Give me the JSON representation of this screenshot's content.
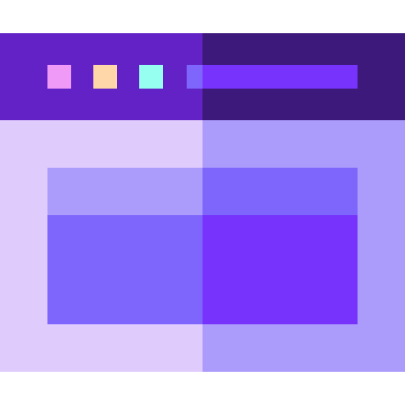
{
  "window": {
    "icon": "browser-window-icon",
    "colors": {
      "titlebar_left": "#6222c6",
      "titlebar_right": "#3c197a",
      "dot_close": "#f09af8",
      "dot_min": "#ffd7a8",
      "dot_max": "#96fff0",
      "addr_left": "#7e66fc",
      "addr_right": "#7733fc",
      "body_left": "#e0ccfc",
      "body_right": "#ab9cfc",
      "header_left": "#ab9cfc",
      "header_right": "#7e66fc",
      "main_left": "#7e66fc",
      "main_right": "#7733fc"
    }
  }
}
